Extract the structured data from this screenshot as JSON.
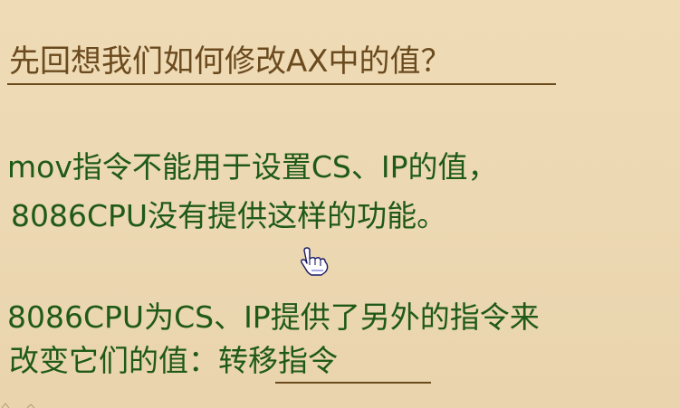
{
  "slide": {
    "heading": "先回想我们如何修改AX中的值？",
    "line1": "mov指令不能用于设置CS、IP的值，",
    "line2": "8086CPU没有提供这样的功能。",
    "line3": "8086CPU为CS、IP提供了另外的指令来",
    "line4_prefix": "改变它们的值：",
    "line4_highlight": "转移指令"
  },
  "colors": {
    "background": "#ecd9b3",
    "heading": "#6b4a1e",
    "body_text": "#1f5a17"
  },
  "icons": {
    "cursor": "hand-pointer-icon"
  }
}
